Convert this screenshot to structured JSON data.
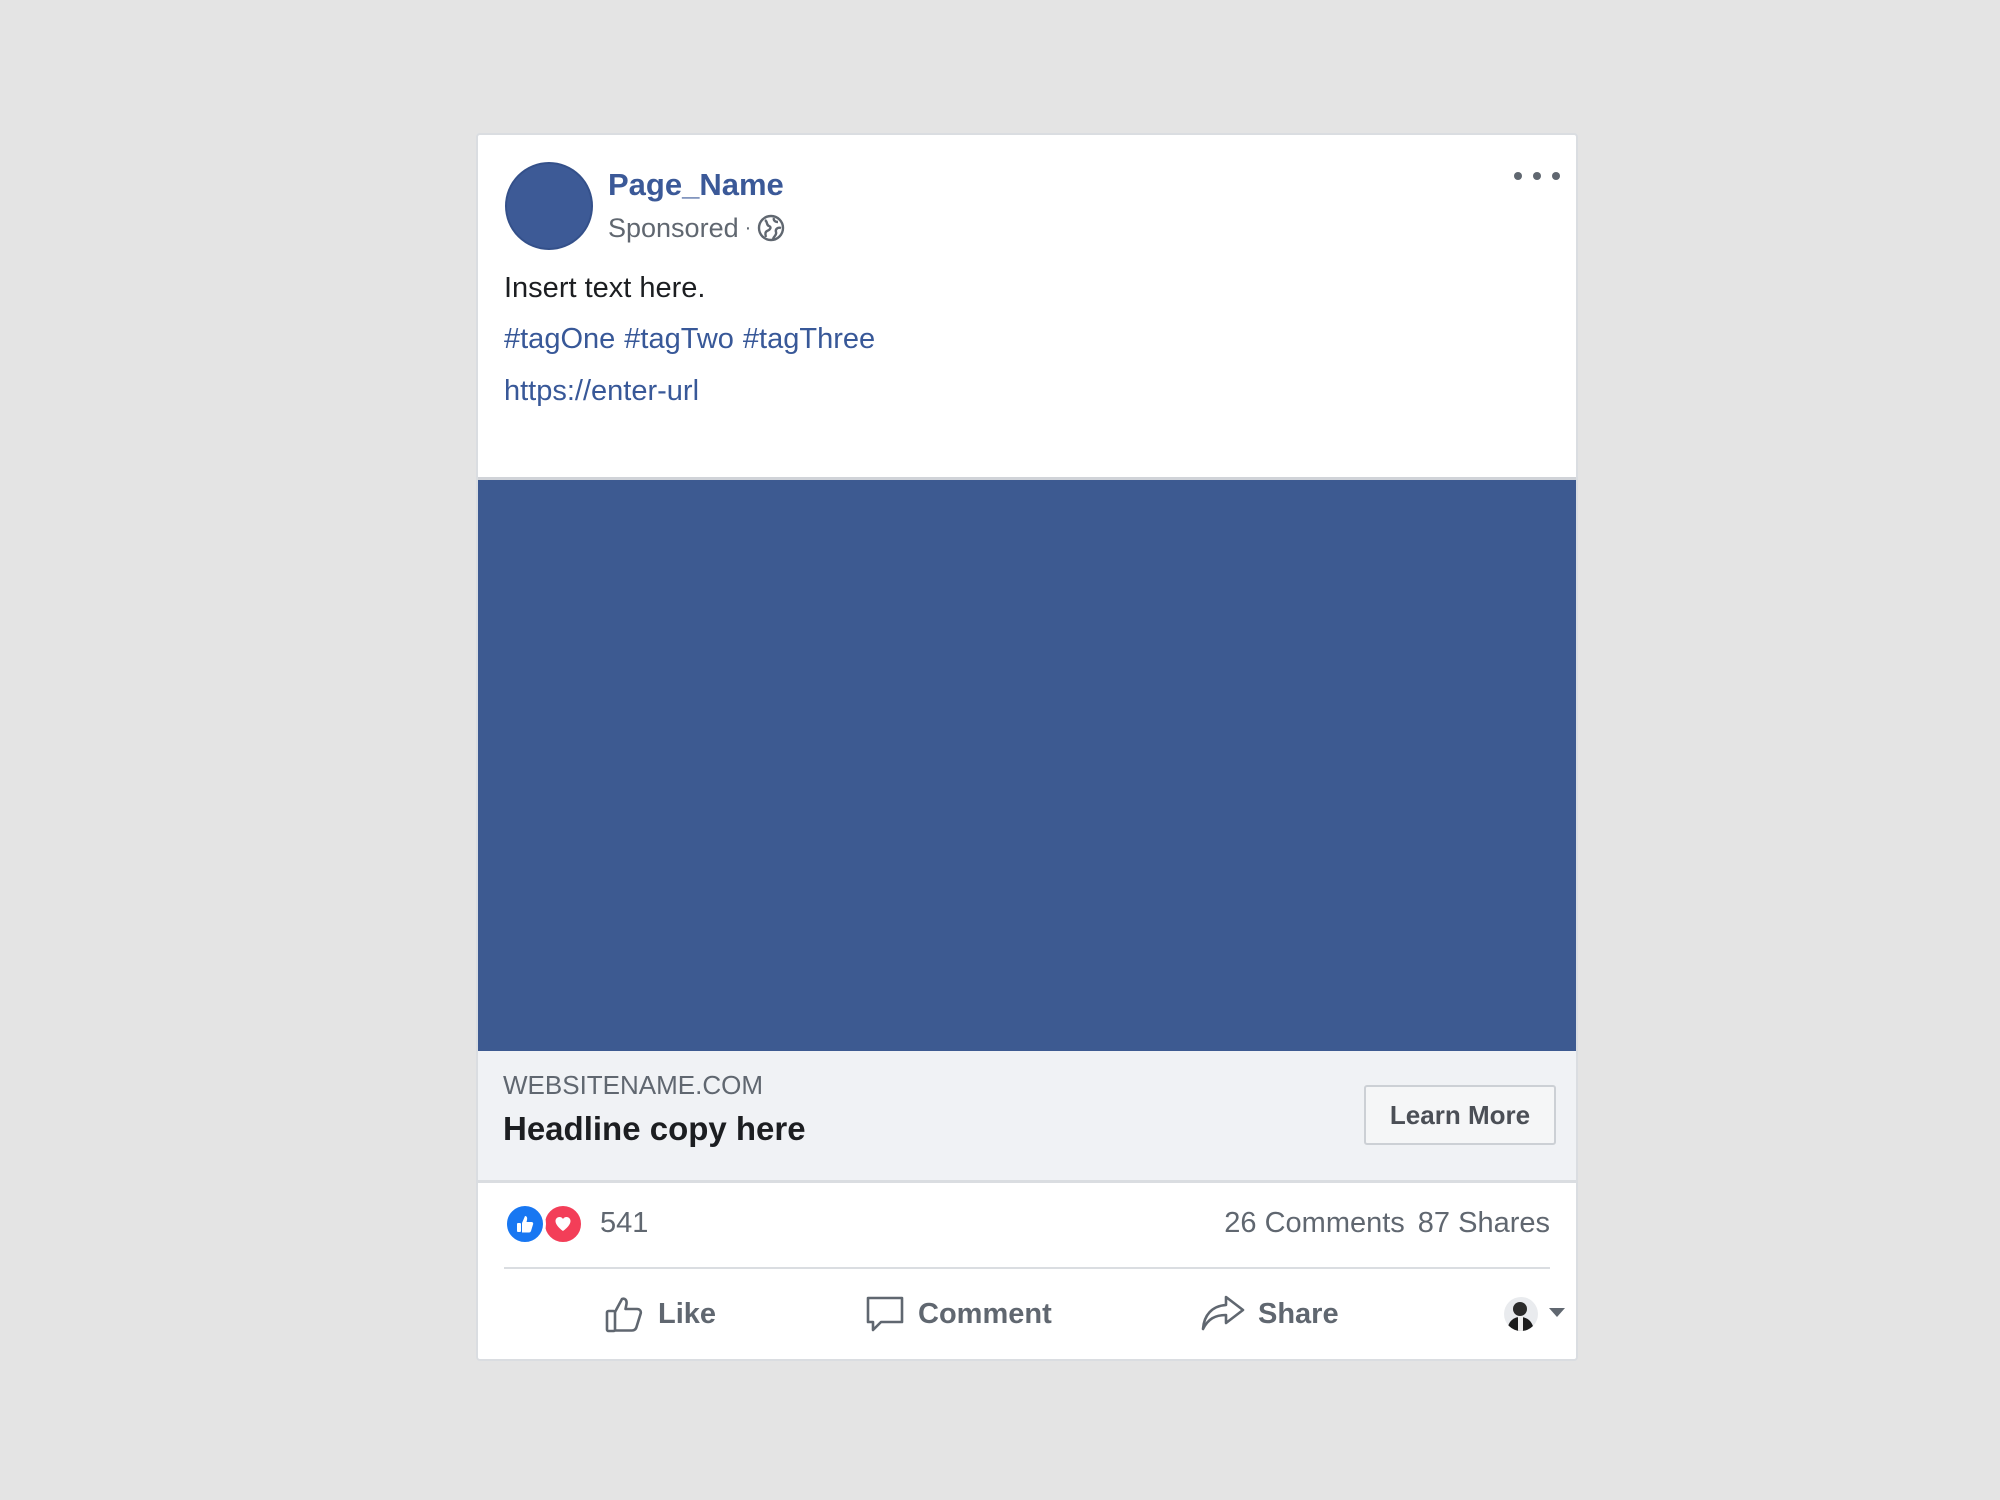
{
  "post": {
    "page_name": "Page_Name",
    "sponsored_label": "Sponsored",
    "separator": "·",
    "body_text": "Insert text here.",
    "hashtags": [
      "#tagOne",
      "#tagTwo",
      "#tagThree"
    ],
    "url": "https://enter-url"
  },
  "link_preview": {
    "domain": "WEBSITENAME.COM",
    "headline": "Headline copy here",
    "cta_label": "Learn More"
  },
  "engagement": {
    "reactions": [
      "like",
      "love"
    ],
    "reaction_count": "541",
    "comments": "26 Comments",
    "shares": "87 Shares"
  },
  "actions": {
    "like_label": "Like",
    "comment_label": "Comment",
    "share_label": "Share"
  },
  "colors": {
    "brand_blue": "#3b5998",
    "media_fill": "#3d5a91",
    "like_blue": "#1877f2",
    "love_red": "#f33e58",
    "page_background": "#e4e4e4"
  },
  "icons": [
    "globe-icon",
    "more-options-icon",
    "like-reaction-icon",
    "love-reaction-icon",
    "thumbs-up-icon",
    "comment-icon",
    "share-icon",
    "chevron-down-icon"
  ]
}
